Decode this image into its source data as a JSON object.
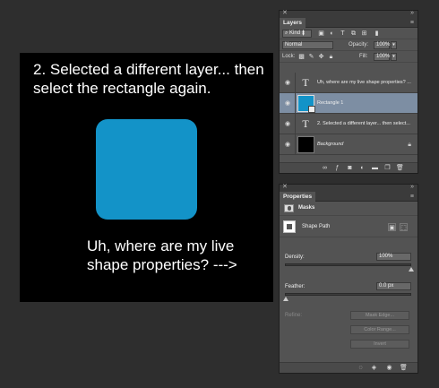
{
  "canvas": {
    "caption1": "2. Selected a different layer... then select the rectangle again.",
    "caption2": "Uh, where are my live shape properties? --->",
    "shape_color": "#1393c8"
  },
  "layers_panel": {
    "tab": "Layers",
    "filter_kind": "⌕ Kind ⬍",
    "blend_mode": "Normal",
    "opacity_label": "Opacity:",
    "opacity_value": "100%",
    "lock_label": "Lock:",
    "fill_label": "Fill:",
    "fill_value": "100%",
    "layers": [
      {
        "name": "Uh, where are my live shape properties? ...",
        "type": "text",
        "selected": false
      },
      {
        "name": "Rectangle 1",
        "type": "shape",
        "selected": true
      },
      {
        "name": "2. Selected a different layer... then select...",
        "type": "text",
        "selected": false
      },
      {
        "name": "Background",
        "type": "background",
        "selected": false
      }
    ]
  },
  "properties_panel": {
    "tab": "Properties",
    "section": "Masks",
    "shape_path": "Shape Path",
    "density_label": "Density:",
    "density_value": "100%",
    "feather_label": "Feather:",
    "feather_value": "0.0 px",
    "refine_label": "Refine:",
    "mask_edge": "Mask Edge...",
    "color_range": "Color Range...",
    "invert": "Invert"
  },
  "icons": {
    "close": "close-icon",
    "collapse": "collapse-icon",
    "menu": "panel-menu-icon",
    "eye": "eye-icon",
    "lock": "lock-icon"
  }
}
